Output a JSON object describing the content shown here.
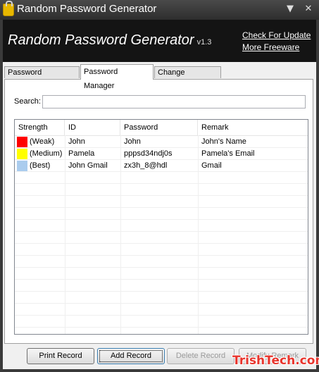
{
  "window": {
    "title": "Random Password Generator",
    "minimize_glyph": "▼",
    "close_glyph": "✕"
  },
  "header": {
    "app_title": "Random Password Generator",
    "version": "v1.3",
    "check_update": "Check For Update",
    "more_freeware": "More Freeware"
  },
  "tabs": [
    {
      "label": "Password Generator",
      "active": false
    },
    {
      "label": "Password Manager",
      "active": true
    },
    {
      "label": "Change Password",
      "active": false
    }
  ],
  "search": {
    "label": "Search:",
    "value": ""
  },
  "table": {
    "columns": [
      "Strength",
      "ID",
      "Password",
      "Remark"
    ],
    "rows": [
      {
        "strength": "(Weak)",
        "color": "#ff0000",
        "id": "John",
        "password": "John",
        "remark": "John's Name"
      },
      {
        "strength": "(Medium)",
        "color": "#ffff00",
        "id": "Pamela",
        "password": "pppsd34ndj0s",
        "remark": "Pamela's Email"
      },
      {
        "strength": "(Best)",
        "color": "#aaccee",
        "id": "John Gmail",
        "password": "zx3h_8@hdl",
        "remark": "Gmail"
      }
    ]
  },
  "buttons": {
    "print": "Print Record",
    "add": "Add Record",
    "delete": "Delete Record",
    "modify": "Modify Remark"
  },
  "watermark": "TrishTech.com"
}
